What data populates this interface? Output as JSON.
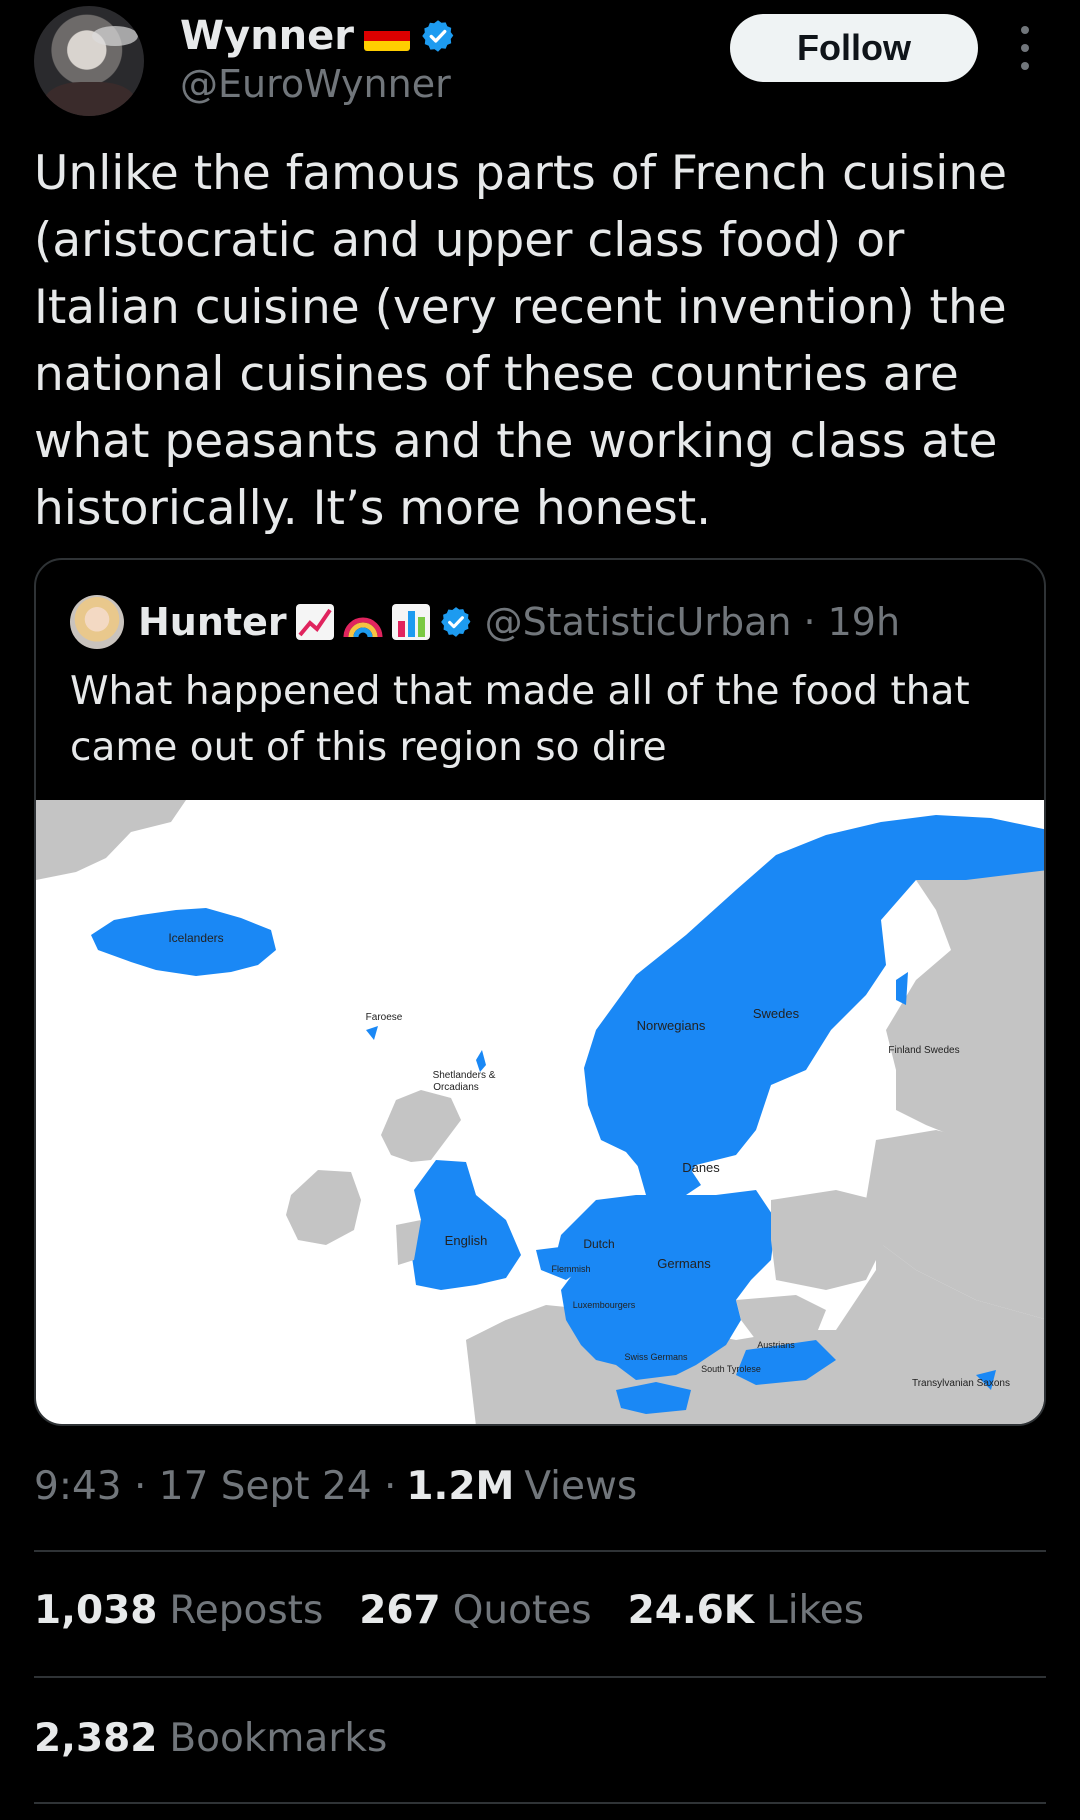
{
  "author": {
    "name": "Wynner",
    "handle": "@EuroWynner",
    "flag_colors": [
      "#000000",
      "#dd0000",
      "#ffce00"
    ],
    "verified_color": "#1d9bf0"
  },
  "follow_label": "Follow",
  "tweet_text": "Unlike the famous parts of French cuisine (aristocratic and upper class food) or Italian cuisine (very recent invention) the national cuisines of these countries are what peasants and the working class ate historically. It’s more honest.",
  "quote": {
    "name": "Hunter",
    "emojis": [
      "chart-increasing-emoji",
      "rainbow-emoji",
      "bar-chart-emoji"
    ],
    "handle": "@StatisticUrban",
    "time": "· 19h",
    "text": "What happened that made all of the food that came out of this region so dire",
    "map_labels": {
      "icelanders": "Icelanders",
      "faroese": "Faroese",
      "shetlanders": "Shetlanders &",
      "orcadians": "Orcadians",
      "norwegians": "Norwegians",
      "swedes": "Swedes",
      "finland_swedes": "Finland Swedes",
      "danes": "Danes",
      "english": "English",
      "dutch": "Dutch",
      "flemish": "Flemmish",
      "germans": "Germans",
      "luxembourgers": "Luxembourgers",
      "swiss_germans": "Swiss Germans",
      "south_tyrolese": "South Tyrolese",
      "austrians": "Austrians",
      "transylvanian_saxons": "Transylvanian Saxons"
    },
    "map_colors": {
      "highlight": "#1a88f5",
      "land": "#c4c4c4",
      "sea": "#ffffff"
    }
  },
  "meta": {
    "time": "9:43 · 17 Sept 24 ·",
    "views_count": "1.2M",
    "views_label": "Views"
  },
  "stats": {
    "reposts_count": "1,038",
    "reposts_label": "Reposts",
    "quotes_count": "267",
    "quotes_label": "Quotes",
    "likes_count": "24.6K",
    "likes_label": "Likes",
    "bookmarks_count": "2,382",
    "bookmarks_label": "Bookmarks"
  }
}
